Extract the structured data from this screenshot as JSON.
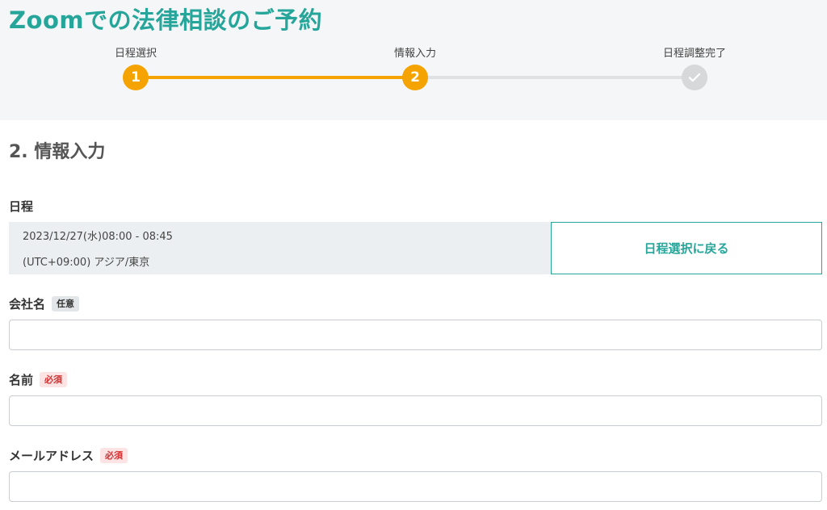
{
  "page": {
    "title": "Zoomでの法律相談のご予約"
  },
  "stepper": {
    "steps": [
      {
        "label": "日程選択",
        "number": "1",
        "state": "done"
      },
      {
        "label": "情報入力",
        "number": "2",
        "state": "current"
      },
      {
        "label": "日程調整完了",
        "icon": "check-icon",
        "state": "pending"
      }
    ]
  },
  "section": {
    "title": "2. 情報入力"
  },
  "schedule": {
    "label": "日程",
    "datetime": "2023/12/27(水)08:00 - 08:45",
    "timezone": "(UTC+09:00) アジア/東京",
    "back_button_label": "日程選択に戻る"
  },
  "form": {
    "company": {
      "label": "会社名",
      "badge": "任意",
      "value": ""
    },
    "name": {
      "label": "名前",
      "badge": "必須",
      "value": ""
    },
    "email": {
      "label": "メールアドレス",
      "badge": "必須",
      "value": ""
    }
  },
  "colors": {
    "brand": "#26a69a",
    "step_active": "#f5a300",
    "step_inactive": "#d6d8da",
    "required_badge": "#d32f2f"
  }
}
